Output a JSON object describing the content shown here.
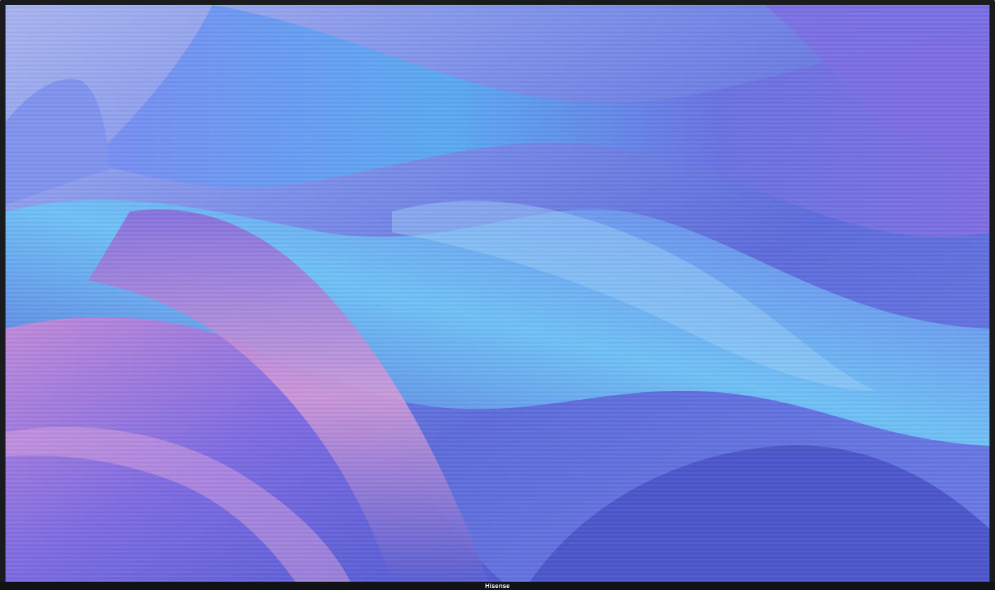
{
  "device": {
    "brand_logo": "Hisense"
  },
  "wallpaper": {
    "icon": "abstract-wave-wallpaper",
    "colors": {
      "base": "#6b7fe6",
      "deep": "#4b56c9",
      "light": "#9fb6f2",
      "cyan": "#58b8f2",
      "pink": "#d99ad8",
      "violet": "#8b5fd6"
    }
  },
  "colors": {
    "bezel": "#1a1b1f",
    "logo": "#ffffff"
  }
}
